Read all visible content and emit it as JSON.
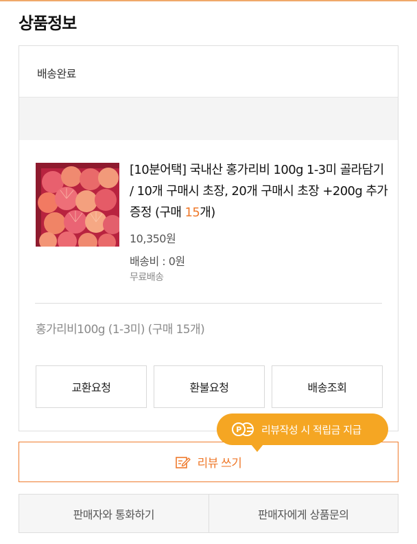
{
  "section": {
    "title": "상품정보"
  },
  "order": {
    "status": "배송완료",
    "product": {
      "image_icon": "scallop-photo",
      "name_main": "[10분어택] 국내산 홍가리비 100g 1-3미 골라담기 / 10개 구매시 초장, 20개 구매시 초장 +200g 추가증정 (구매 ",
      "name_qty": "15",
      "name_tail": "개)",
      "price": "10,350원",
      "shipping_fee": "배송비 : 0원",
      "shipping_type": "무료배송"
    },
    "option": "홍가리비100g (1-3미) (구매 15개)",
    "actions": {
      "exchange": "교환요청",
      "refund": "환불요청",
      "tracking": "배송조회"
    }
  },
  "tooltip": {
    "icon": "point-coins-icon",
    "coin_letter": "P",
    "text": "리뷰작성 시 적립금 지급"
  },
  "review": {
    "icon": "edit-note-icon",
    "label": "리뷰 쓰기"
  },
  "seller": {
    "call": "판매자와 통화하기",
    "inquiry": "판매자에게 상품문의"
  },
  "colors": {
    "accent": "#ef7a2c",
    "tooltip": "#f5a623",
    "border": "#dedede"
  }
}
